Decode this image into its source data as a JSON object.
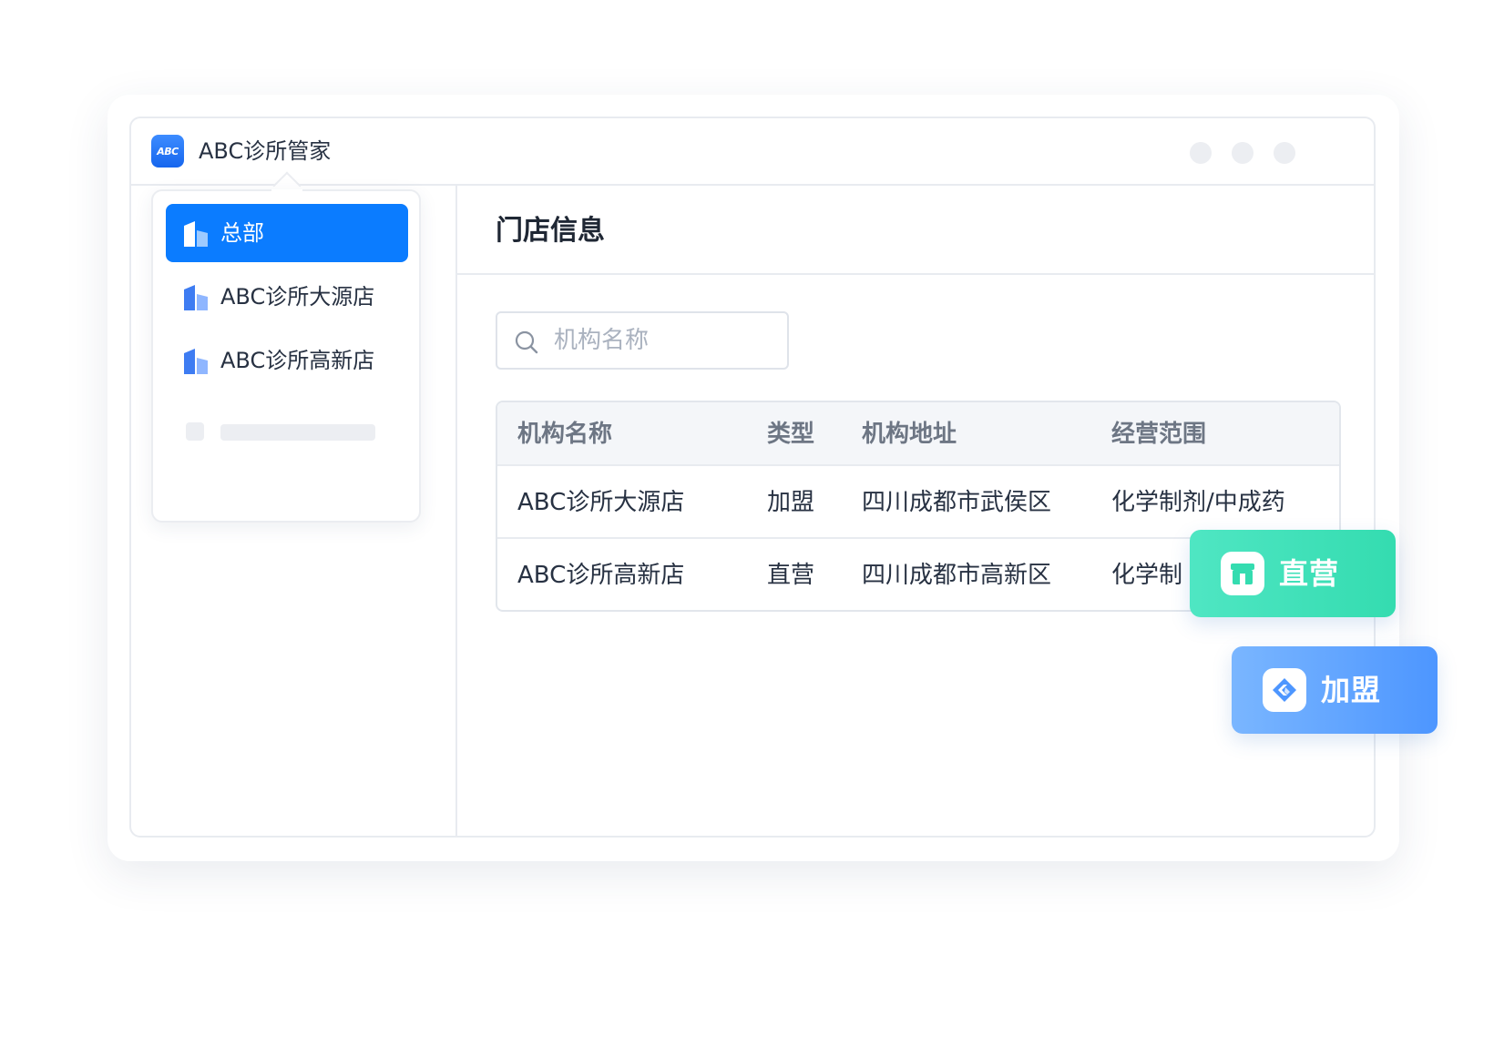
{
  "app": {
    "logo_text": "ABC",
    "title": "ABC诊所管家"
  },
  "org_switcher": {
    "items": [
      {
        "label": "总部",
        "selected": true
      },
      {
        "label": "ABC诊所大源店",
        "selected": false
      },
      {
        "label": "ABC诊所高新店",
        "selected": false
      }
    ]
  },
  "main": {
    "page_title": "门店信息",
    "search": {
      "placeholder": "机构名称",
      "value": ""
    },
    "table": {
      "columns": [
        "机构名称",
        "类型",
        "机构地址",
        "经营范围"
      ],
      "rows": [
        [
          "ABC诊所大源店",
          "加盟",
          "四川成都市武侯区",
          "化学制剂/中成药"
        ],
        [
          "ABC诊所高新店",
          "直营",
          "四川成都市高新区",
          "化学制"
        ]
      ]
    }
  },
  "floating_tags": {
    "direct": {
      "label": "直营",
      "icon": "store-icon"
    },
    "franchise": {
      "label": "加盟",
      "icon": "handshake-icon"
    }
  },
  "colors": {
    "accent": "#0b7cff",
    "direct_tag": "#34dcb0",
    "franchise_tag": "#4d96ff"
  }
}
